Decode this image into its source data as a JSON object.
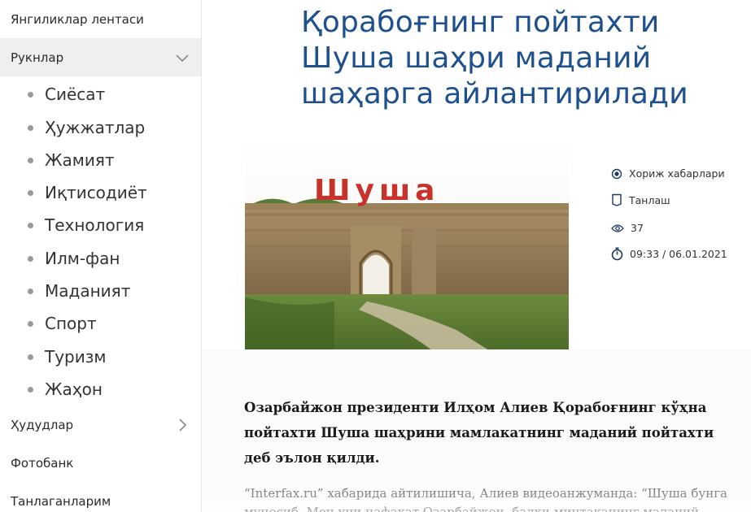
{
  "sidebar": {
    "news_feed": "Янгиликлар лентаси",
    "sections": "Рукнлар",
    "sub_items": [
      "Сиёсат",
      "Ҳужжатлар",
      "Жамият",
      "Иқтисодиёт",
      "Технология",
      "Илм-фан",
      "Маданият",
      "Спорт",
      "Туризм",
      "Жаҳон"
    ],
    "regions": "Ҳудудлар",
    "photobank": "Фотобанк",
    "favorites": "Танлаганларим"
  },
  "article": {
    "title": "Қорабоғнинг пойтахти Шуша шаҳри маданий шаҳарга айлантирилади",
    "image_sign": "Шуша",
    "category": "Хориж хабарлари",
    "bookmark": "Танлаш",
    "views": "37",
    "datetime": "09:33 / 06.01.2021",
    "lead": "Озарбайжон президенти Илҳом Алиев Қорабоғнинг кўҳна пойтахти Шуша шаҳрини мамлакатнинг маданий пойтахти деб эълон қилди.",
    "body": "“Interfax.ru” хабарида айтилишича, Алиев видеоанжуманда: “Шуша бунга муносиб. Мен уни нафақат Озарбайжон, балки минтақанинг маданий"
  },
  "colors": {
    "title": "#1e4f8f",
    "sidebar_active": "#efefef",
    "sign_red": "#c8322b"
  },
  "icons": {
    "category": "radio-dot-icon",
    "bookmark": "bookmark-icon",
    "views": "eye-icon",
    "time": "stopwatch-icon",
    "expand": "chevron-down-icon",
    "regions": "chevron-right-icon"
  }
}
